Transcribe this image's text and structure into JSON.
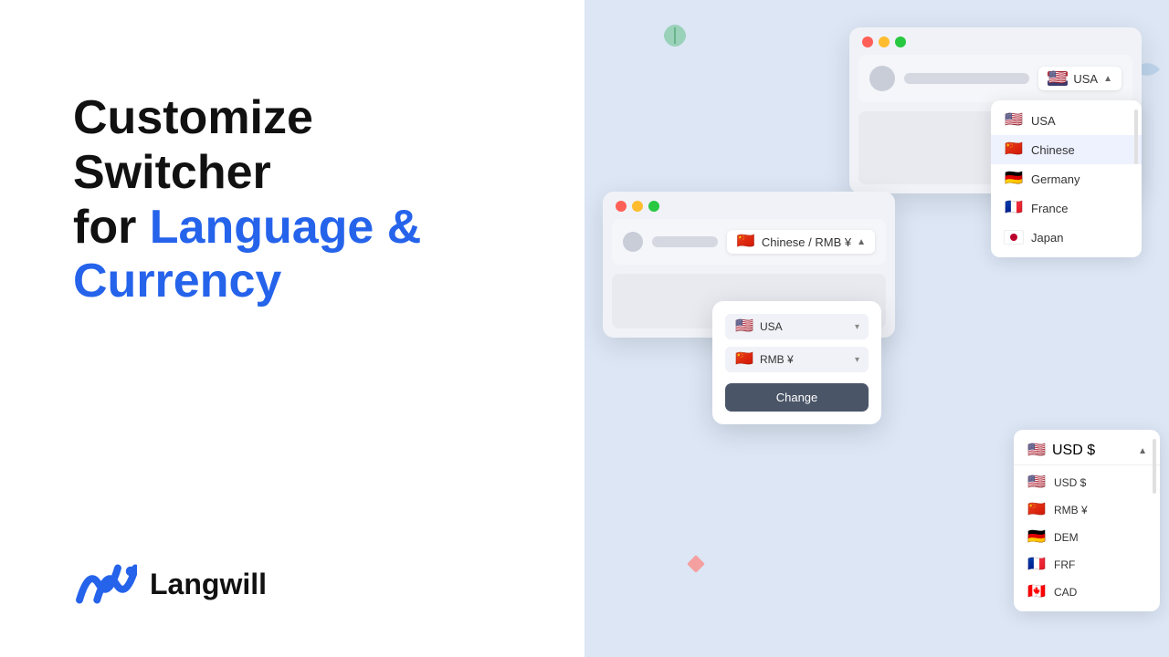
{
  "left": {
    "headline_line1": "Customize Switcher",
    "headline_line2_plain": "for ",
    "headline_line2_blue": "Language &",
    "headline_line3_blue": "Currency",
    "logo_text": "Langwill"
  },
  "right": {
    "browser_main": {
      "avatar_alt": "avatar",
      "dropdown_label": "USA",
      "dropdown_arrow": "▲"
    },
    "lang_dropdown": {
      "items": [
        {
          "label": "USA",
          "flag": "us",
          "selected": false
        },
        {
          "label": "Chinese",
          "flag": "cn",
          "selected": true
        },
        {
          "label": "Germany",
          "flag": "de",
          "selected": false
        },
        {
          "label": "France",
          "flag": "fr",
          "selected": false
        },
        {
          "label": "Japan",
          "flag": "jp",
          "selected": false
        }
      ]
    },
    "browser_small": {
      "dropdown_label": "Chinese / RMB ¥",
      "dropdown_arrow": "▲"
    },
    "switcher": {
      "lang_select": "USA",
      "currency_select": "RMB ¥",
      "change_btn": "Change"
    },
    "currency_dropdown": {
      "header_label": "USD $",
      "header_arrow": "▲",
      "items": [
        {
          "label": "USD $",
          "flag": "us"
        },
        {
          "label": "RMB ¥",
          "flag": "cn"
        },
        {
          "label": "DEM",
          "flag": "de"
        },
        {
          "label": "FRF",
          "flag": "fr"
        },
        {
          "label": "CAD",
          "flag": "ca"
        }
      ]
    }
  }
}
